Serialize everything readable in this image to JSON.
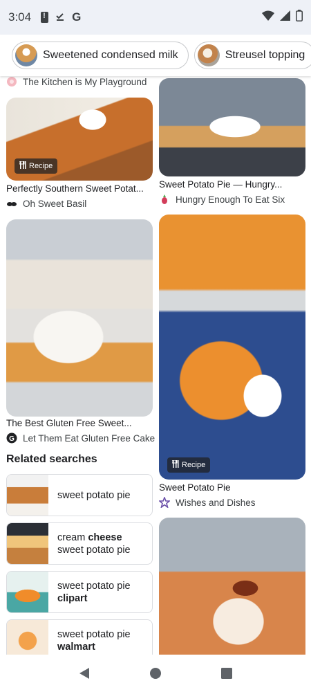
{
  "status_bar": {
    "time": "3:04",
    "icons_left": [
      "sim-alert-icon",
      "download-done-icon",
      "google-g-icon"
    ],
    "g_letter": "G",
    "icons_right": [
      "wifi-icon",
      "signal-icon",
      "battery-icon"
    ]
  },
  "chips": [
    {
      "label": "Sweetened condensed milk"
    },
    {
      "label": "Streusel topping"
    }
  ],
  "cards": [
    {
      "title": "",
      "source": "The Kitchen is My Playground",
      "recipe_badge": ""
    },
    {
      "title": "Perfectly Southern Sweet Potat...",
      "source": "Oh Sweet Basil",
      "recipe_badge": "Recipe"
    },
    {
      "title": "Sweet Potato Pie — Hungry...",
      "source": "Hungry Enough To Eat Six",
      "recipe_badge": ""
    },
    {
      "title": "The Best Gluten Free Sweet...",
      "source": "Let Them Eat Gluten Free Cake",
      "recipe_badge": ""
    },
    {
      "title": "Sweet Potato Pie",
      "source": "Wishes and Dishes",
      "recipe_badge": "Recipe"
    }
  ],
  "related": {
    "heading": "Related searches",
    "items": [
      {
        "line1": "sweet potato pie",
        "line1_bold": "",
        "line2": "",
        "line2_bold": ""
      },
      {
        "line1": "cream ",
        "line1_bold": "cheese",
        "line2": "sweet potato pie",
        "line2_bold": ""
      },
      {
        "line1": "sweet potato pie",
        "line1_bold": "",
        "line2": "",
        "line2_bold": "clipart"
      },
      {
        "line1": "sweet potato pie",
        "line1_bold": "",
        "line2": "",
        "line2_bold": "walmart"
      }
    ]
  },
  "nav": [
    "back-icon",
    "home-icon",
    "recents-icon"
  ],
  "colors": {
    "status_bg": "#eef1f7",
    "chip_border": "#c7c9cc",
    "text": "#202124"
  }
}
